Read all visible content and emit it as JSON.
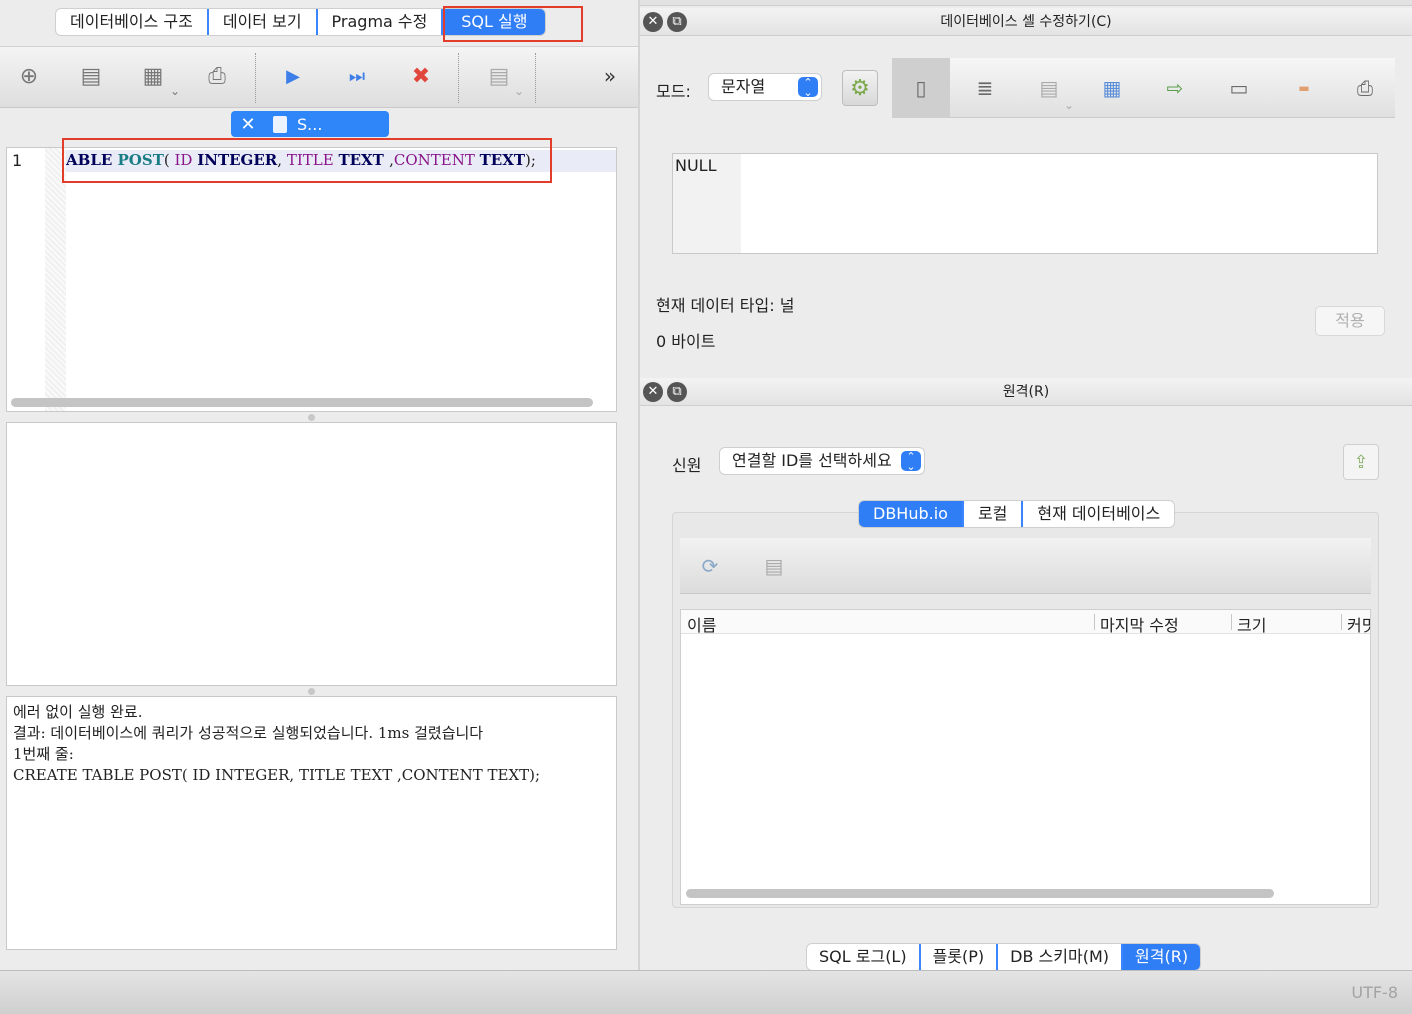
{
  "left_tabs": {
    "db_structure": "데이터베이스 구조",
    "browse_data": "데이터 보기",
    "pragma": "Pragma 수정",
    "execute_sql": "SQL 실행"
  },
  "query_tab": {
    "label": "S..."
  },
  "editor": {
    "line_number": "1",
    "code_tokens": {
      "t1": "ABLE ",
      "t2": "POST",
      "t3": "( ",
      "t4": "ID ",
      "t5": "INTEGER",
      "t6": ", ",
      "t7": "TITLE ",
      "t8": " TEXT ",
      "t9": ",",
      "t10": "CONTENT ",
      "t11": "TEXT",
      "t12": ");"
    }
  },
  "message": {
    "line1": "에러 없이 실행 완료.",
    "line2": "결과: 데이터베이스에 쿼리가 성공적으로 실행되었습니다. 1ms 걸렸습니다",
    "line3": "1번째 줄:",
    "line4": "CREATE TABLE POST( ID INTEGER, TITLE  TEXT ,CONTENT TEXT);"
  },
  "edit_cell": {
    "title": "데이터베이스 셀 수정하기(C)",
    "mode_label": "모드:",
    "mode_value": "문자열",
    "cell_value": "NULL",
    "type_label": "현재 데이터 타입: 널",
    "size_label": "0 바이트",
    "apply_label": "적용"
  },
  "remote": {
    "title": "원격(R)",
    "identity_label": "신원",
    "identity_select": "연결할 ID를 선택하세요",
    "tabs": {
      "dbhub": "DBHub.io",
      "local": "로컬",
      "current_db": "현재 데이터베이스"
    },
    "columns": {
      "name": "이름",
      "last_modified": "마지막 수정",
      "size": "크기",
      "commit": "커밋"
    }
  },
  "bottom_tabs": {
    "sql_log": "SQL 로그(L)",
    "plot": "플롯(P)",
    "db_schema": "DB 스키마(M)",
    "remote": "원격(R)"
  },
  "status": {
    "encoding": "UTF-8"
  },
  "colors": {
    "accent": "#2f7ef6",
    "highlight_box": "#e23c2b"
  },
  "icons": {
    "left_toolbar": [
      "open-tab-icon",
      "open-sql-icon",
      "save-sql-icon",
      "print-icon",
      "execute-all-icon",
      "execute-line-icon",
      "stop-icon",
      "save-results-icon",
      "more-icon"
    ],
    "cell_toolbar": [
      "text-mode-icon",
      "indent-icon",
      "import-icon",
      "export-icon",
      "set-null-icon",
      "copy-icon",
      "clear-icon",
      "print-icon"
    ]
  }
}
